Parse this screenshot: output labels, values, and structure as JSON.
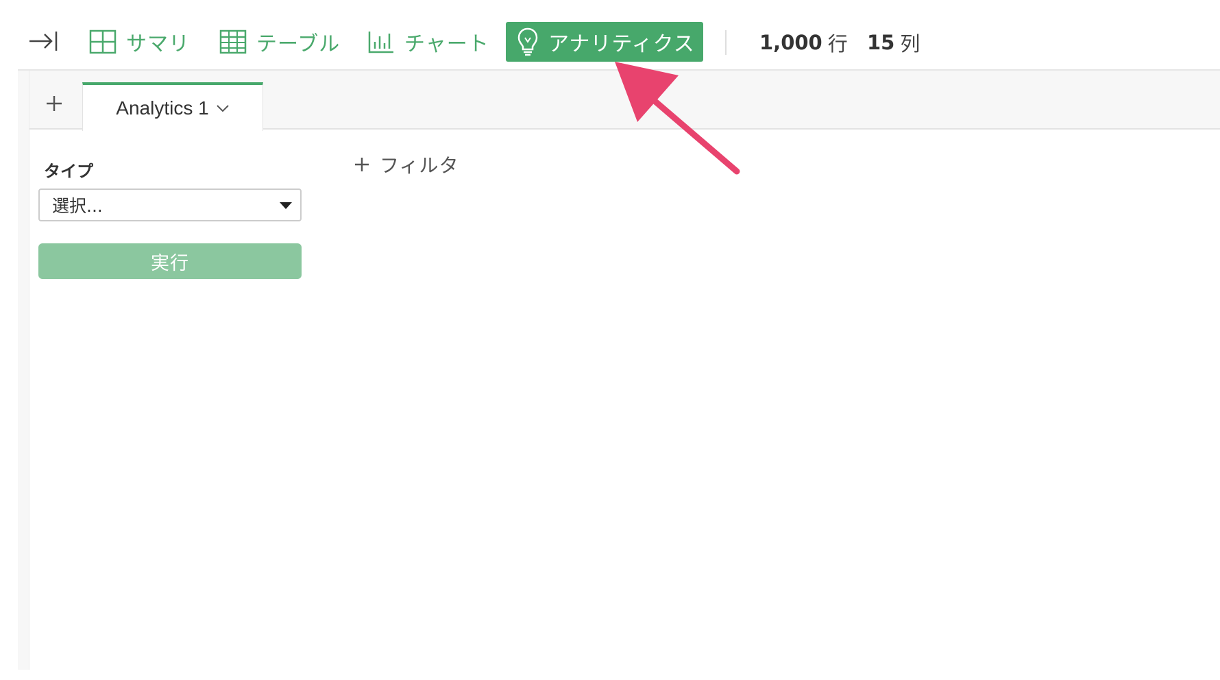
{
  "toolbar": {
    "nav": [
      {
        "label": "サマリ",
        "icon": "grid-2x2-icon"
      },
      {
        "label": "テーブル",
        "icon": "table-icon"
      },
      {
        "label": "チャート",
        "icon": "bar-chart-icon"
      },
      {
        "label": "アナリティクス",
        "icon": "lightbulb-icon",
        "active": true
      }
    ],
    "rows_count": "1,000",
    "rows_unit": "行",
    "cols_count": "15",
    "cols_unit": "列"
  },
  "tabs": {
    "items": [
      {
        "label": "Analytics 1"
      }
    ]
  },
  "panel": {
    "type_label": "タイプ",
    "type_select_value": "選択...",
    "run_label": "実行",
    "add_filter_label": "フィルタ"
  },
  "colors": {
    "accent_green": "#47a86b",
    "disabled_green": "#8bc79f",
    "annotation_pink": "#e8436e"
  }
}
